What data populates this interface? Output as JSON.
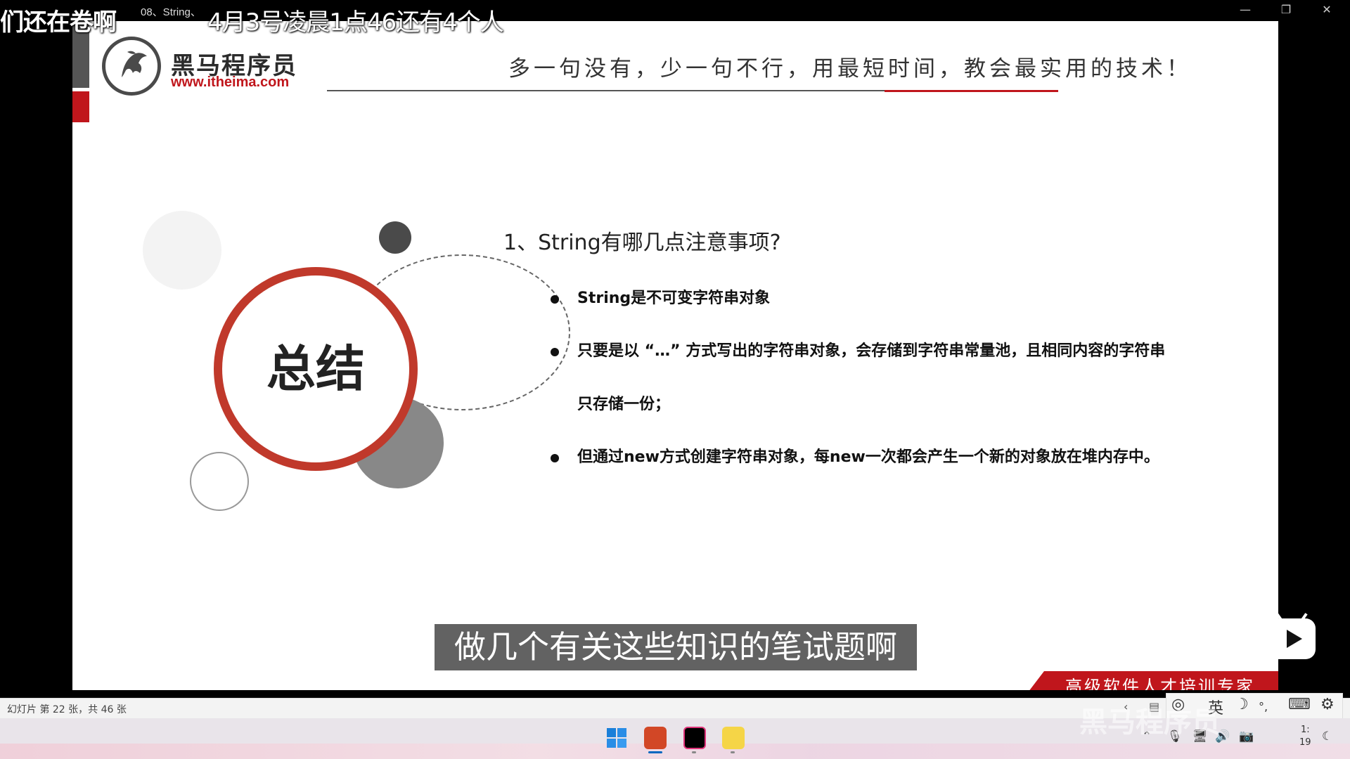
{
  "window": {
    "app_title": "08、String、",
    "minimize": "—",
    "restore": "❐",
    "close": "✕"
  },
  "danmaku": [
    "们还在卷啊",
    "4月3号凌晨1点46还有4个人"
  ],
  "slide": {
    "logo": {
      "name": "黑马程序员",
      "url": "www.itheima.com"
    },
    "slogan": "多一句没有，少一句不行，用最短时间，教会最实用的技术！",
    "summary_title": "总结",
    "question": "1、String有哪几点注意事项?",
    "bullets": [
      "String是不可变字符串对象",
      "只要是以 “…” 方式写出的字符串对象，会存储到字符串常量池，且相同内容的字符串",
      "只存储一份；",
      "但通过new方式创建字符串对象，每new一次都会产生一个新的对象放在堆内存中。"
    ],
    "banner": "高级软件人才培训专家",
    "colors": {
      "accent_red": "#c0161c",
      "ring_red": "#c0392b",
      "dark_gray": "#4a4a4a"
    }
  },
  "subtitle": "做几个有关这些知识的笔试题啊",
  "status_bar": {
    "slide_count": "幻灯片 第 22 张，共 46 张",
    "ime": {
      "lang": "英",
      "prev": "‹"
    }
  },
  "taskbar": {
    "apps": [
      "windows-start",
      "powerpoint",
      "intellij-idea",
      "sticky-notes"
    ],
    "clock": {
      "line1": "1:",
      "line2": "19"
    }
  },
  "watermark": "黑马程序员"
}
